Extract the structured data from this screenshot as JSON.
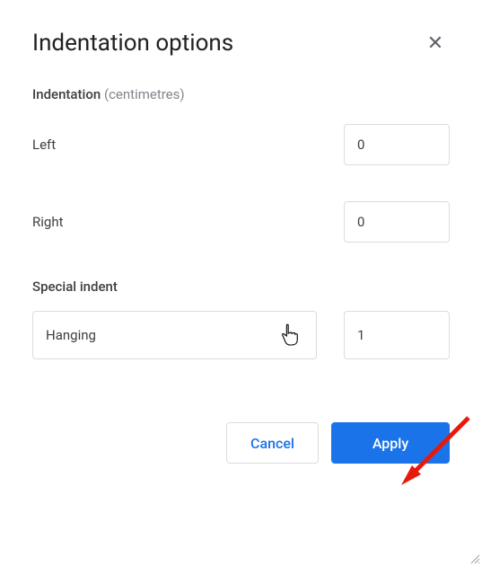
{
  "dialog": {
    "title": "Indentation options",
    "close_icon": "✕"
  },
  "indentation": {
    "section_label": "Indentation",
    "unit_label": "(centimetres)",
    "left_label": "Left",
    "left_value": "0",
    "right_label": "Right",
    "right_value": "0"
  },
  "special": {
    "label": "Special indent",
    "selected": "Hanging",
    "amount": "1"
  },
  "buttons": {
    "cancel": "Cancel",
    "apply": "Apply"
  }
}
